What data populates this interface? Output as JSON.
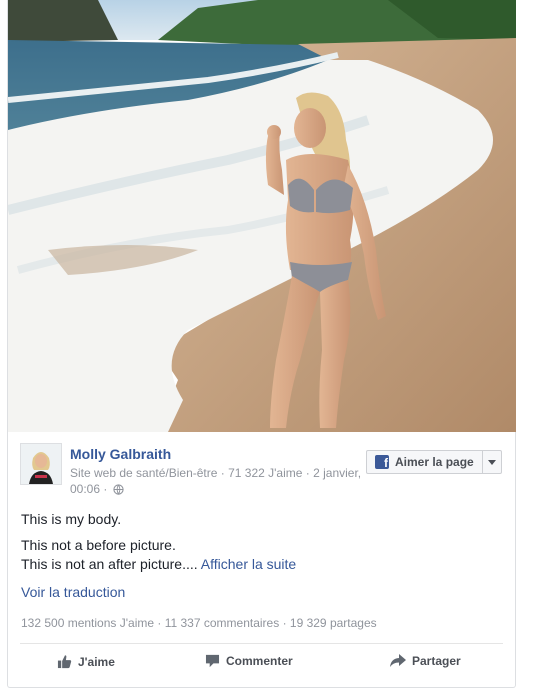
{
  "photo": {
    "alt": "Woman in grey bikini standing on beach"
  },
  "page": {
    "name": "Molly Galbraith",
    "category": "Site web de santé/Bien-être",
    "likes": "71 322 J'aime",
    "date_prefix": "2 janvier,",
    "time": "00:06",
    "like_button_label": "Aimer la page"
  },
  "post": {
    "line1": "This is my body.",
    "line2": "This not a before picture.",
    "line3": "This is not an after picture....",
    "see_more": "Afficher la suite",
    "translate": "Voir la traduction"
  },
  "stats": {
    "likes": "132 500 mentions J'aime",
    "comments": "11 337 commentaires",
    "shares": "19 329 partages",
    "separator": " · "
  },
  "actions": {
    "like": "J'aime",
    "comment": "Commenter",
    "share": "Partager"
  },
  "colors": {
    "link": "#365899",
    "meta": "#90949c",
    "facebook_blue": "#3b5998"
  }
}
